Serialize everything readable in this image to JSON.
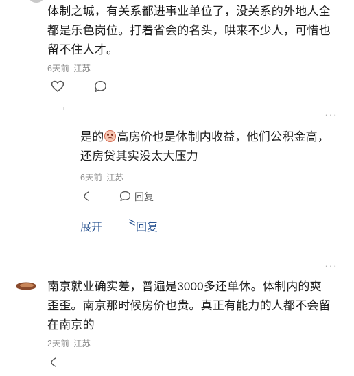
{
  "comment1": {
    "text_line1": "体制之城，有关系都进事业单位了，没关系的外地人全",
    "text_line2": "都是乐色岗位。打着省会的名头，哄来不少人，可惜也",
    "text_line3": "留不住人才。",
    "time": "6天前",
    "location": "江苏"
  },
  "reply1": {
    "text_prefix": "是的",
    "emoji": "blush-emoji",
    "text_line1_rest": "高房价也是体制内收益，他们公积金高，",
    "text_line2": "还房贷其实没太大压力",
    "time": "6天前",
    "location": "江苏",
    "reply_label": "回复",
    "more": "···"
  },
  "thread": {
    "expand_label": "展开",
    "collapse_label": "回复"
  },
  "comment2": {
    "text_line1": "南京就业确实差，普遍是3000多还单休。体制内的爽",
    "text_line2": "歪歪。南京那时候房价也贵。真正有能力的人都不会留",
    "text_line3": "在南京的",
    "time": "2天前",
    "location": "江苏",
    "more": "···"
  },
  "colors": {
    "link": "#2b5592",
    "meta": "#8c8c8c",
    "text": "#1f1f1f"
  }
}
